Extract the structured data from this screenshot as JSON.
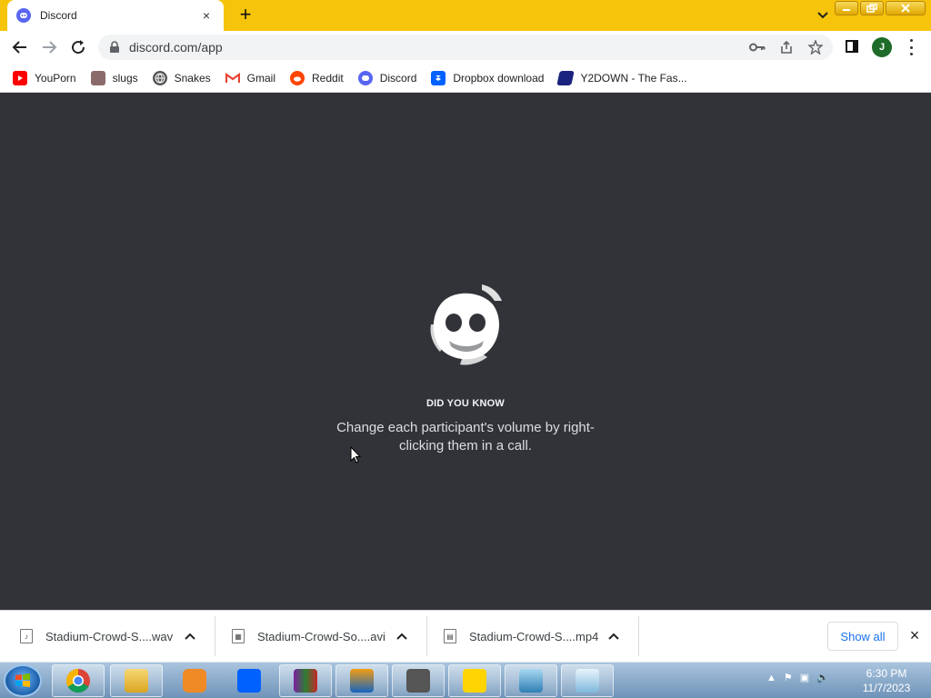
{
  "browser": {
    "tab": {
      "title": "Discord",
      "close": "×"
    },
    "new_tab": "+",
    "url": "discord.com/app",
    "profile_initial": "J",
    "accent": "#f6c40a"
  },
  "bookmarks": [
    {
      "label": "YouPorn",
      "icon": "youtube-icon",
      "color": "#ff0000"
    },
    {
      "label": "slugs",
      "icon": "image-icon",
      "color": "#8a6a6a"
    },
    {
      "label": "Snakes",
      "icon": "globe-icon",
      "color": "#555555"
    },
    {
      "label": "Gmail",
      "icon": "gmail-icon",
      "color": "#ea4335"
    },
    {
      "label": "Reddit",
      "icon": "reddit-icon",
      "color": "#ff4500"
    },
    {
      "label": "Discord",
      "icon": "discord-icon",
      "color": "#5865f2"
    },
    {
      "label": "Dropbox download",
      "icon": "dropbox-icon",
      "color": "#0061fe"
    },
    {
      "label": "Y2DOWN - The Fas...",
      "icon": "y2down-icon",
      "color": "#1a237e"
    }
  ],
  "main": {
    "tip_heading": "DID YOU KNOW",
    "tip_text": "Change each participant's volume by right-clicking them in a call.",
    "background": "#313338"
  },
  "downloads": {
    "items": [
      {
        "name": "Stadium-Crowd-S....wav",
        "chevron": "^"
      },
      {
        "name": "Stadium-Crowd-So....avi",
        "chevron": "^"
      },
      {
        "name": "Stadium-Crowd-S....mp4",
        "chevron": "^"
      }
    ],
    "show_all": "Show all",
    "close": "×"
  },
  "taskbar": {
    "time": "6:30 PM",
    "date": "11/7/2023",
    "apps": [
      "chrome-icon",
      "file-explorer-icon",
      "media-player-icon",
      "dropbox-icon",
      "winrar-icon",
      "firefox-like-icon",
      "game-icon",
      "sticky-notes-icon",
      "photo-viewer-icon",
      "notepad-icon"
    ]
  }
}
